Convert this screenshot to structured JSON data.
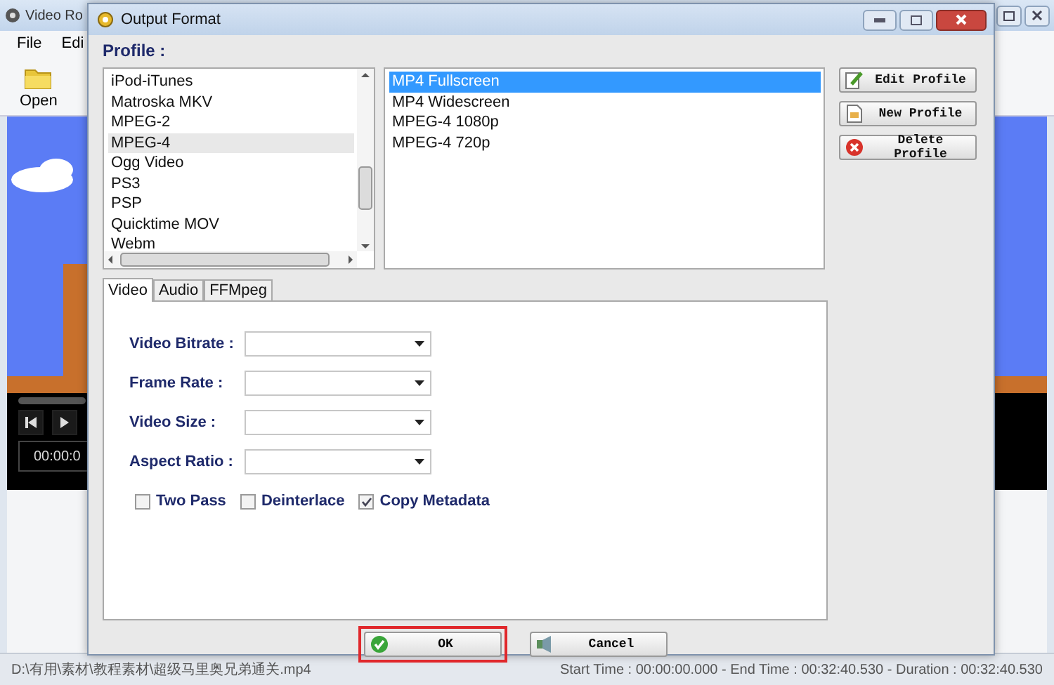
{
  "background_window": {
    "title": "Video Ro",
    "menu": [
      "File",
      "Edi"
    ],
    "toolbar": [
      {
        "kind": "open",
        "label": "Open"
      }
    ],
    "player": {
      "time": "00:00:0"
    },
    "status_bar": {
      "path": "D:\\有用\\素材\\教程素材\\超级马里奥兄弟通关.mp4",
      "times": "Start Time : 00:00:00.000 - End Time : 00:32:40.530 - Duration : 00:32:40.530"
    }
  },
  "dialog": {
    "title": "Output Format",
    "profile_label": "Profile :",
    "formats": [
      {
        "label": "iPod-iTunes",
        "selected": false
      },
      {
        "label": "Matroska MKV",
        "selected": false
      },
      {
        "label": "MPEG-2",
        "selected": false
      },
      {
        "label": "MPEG-4",
        "selected": true
      },
      {
        "label": "Ogg Video",
        "selected": false
      },
      {
        "label": "PS3",
        "selected": false
      },
      {
        "label": "PSP",
        "selected": false
      },
      {
        "label": "Quicktime MOV",
        "selected": false
      },
      {
        "label": "Webm",
        "selected": false
      }
    ],
    "profiles": [
      {
        "label": "MP4 Fullscreen",
        "selected": true
      },
      {
        "label": "MP4 Widescreen",
        "selected": false
      },
      {
        "label": "MPEG-4 1080p",
        "selected": false
      },
      {
        "label": "MPEG-4 720p",
        "selected": false
      }
    ],
    "profile_buttons": [
      {
        "kind": "edit",
        "label": "Edit Profile"
      },
      {
        "kind": "new",
        "label": "New Profile"
      },
      {
        "kind": "delete",
        "label": "Delete Profile"
      }
    ],
    "tabs": [
      {
        "label": "Video",
        "selected": true
      },
      {
        "label": "Audio",
        "selected": false
      },
      {
        "label": "FFMpeg",
        "selected": false
      }
    ],
    "fields": [
      {
        "label": "Video Bitrate :"
      },
      {
        "label": "Frame Rate :"
      },
      {
        "label": "Video Size :"
      },
      {
        "label": "Aspect Ratio :"
      }
    ],
    "options": [
      {
        "label": "Two Pass",
        "checked": false
      },
      {
        "label": "Deinterlace",
        "checked": false
      },
      {
        "label": "Copy Metadata",
        "checked": true
      }
    ],
    "buttons": [
      {
        "kind": "ok",
        "label": "OK",
        "highlighted": true
      },
      {
        "kind": "cancel",
        "label": "Cancel",
        "highlighted": false
      }
    ]
  }
}
